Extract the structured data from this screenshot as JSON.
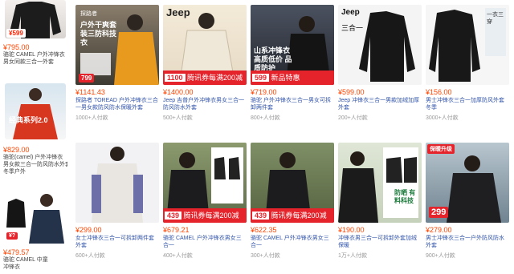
{
  "left": {
    "top_price": "¥599",
    "price1": "¥795.00",
    "text1": "骆驼 CAMEL 户外冲锋衣",
    "text1b": "男女同款三合一外套",
    "thumb1_title": "经典系列2.0",
    "price2": "¥829.00",
    "text2a": "骆驼(camel) 户外冲锋衣",
    "text2b": "男女款三合一防风防水外套",
    "text2c": "冬季户外",
    "price3": "¥479.57",
    "text3a": "骆驼 CAMEL 中童",
    "text3b": "冲锋衣"
  },
  "row1": [
    {
      "price": "¥1141.43",
      "title": "探路者 TOREAD 户外冲锋衣三合一男女款防风防水保暖外套",
      "meta": "1000+人付款",
      "img_text": "户外干爽套装三防科技衣",
      "badge": "799",
      "brand": "探路者"
    },
    {
      "price": "¥1400.00",
      "title": "Jeep 吉普户外冲锋衣男女三合一防风防水外套",
      "meta": "500+人付款",
      "img_text": "Jeep",
      "badge": "1100",
      "banner": "腾讯券每满200减30"
    },
    {
      "price": "¥719.00",
      "title": "骆驼 户外冲锋衣三合一男女可拆卸两件套",
      "meta": "800+人付款",
      "img_text": "山系冲锋衣 高质低价 品质防护",
      "badge": "599",
      "banner": "新品特惠"
    },
    {
      "price": "¥599.00",
      "title": "Jeep 冲锋衣三合一男款加绒加厚外套",
      "meta": "200+人付款",
      "img_text": "三合一",
      "brand": "Jeep"
    },
    {
      "price": "¥156.00",
      "title": "男士冲锋衣三合一加厚防风外套冬季",
      "meta": "3000+人付款",
      "img_text": "一衣三穿"
    }
  ],
  "row2": [
    {
      "price": "¥299.00",
      "title": "女士冲锋衣三合一可拆卸两件套外套",
      "meta": "600+人付款"
    },
    {
      "price": "¥679.21",
      "title": "骆驼 CAMEL 户外冲锋衣男女三合一",
      "meta": "400+人付款",
      "badge": "439",
      "banner": "腾讯券每满200减30"
    },
    {
      "price": "¥622.35",
      "title": "骆驼 CAMEL 户外冲锋衣男女三合一",
      "meta": "300+人付款",
      "badge": "439",
      "banner": "腾讯券每满200减30"
    },
    {
      "price": "¥190.00",
      "title": "冲锋衣男三合一可拆卸外套加绒保暖",
      "meta": "1万+人付款",
      "img_text": "防晒 有料科技"
    },
    {
      "price": "¥279.00",
      "title": "男士冲锋衣三合一户外防风防水外套",
      "meta": "900+人付款",
      "badge": "299",
      "img_text": "保暖升级"
    }
  ],
  "colors": {
    "accent": "#ff4400",
    "banner": "#e4232b",
    "link": "#3355aa"
  }
}
